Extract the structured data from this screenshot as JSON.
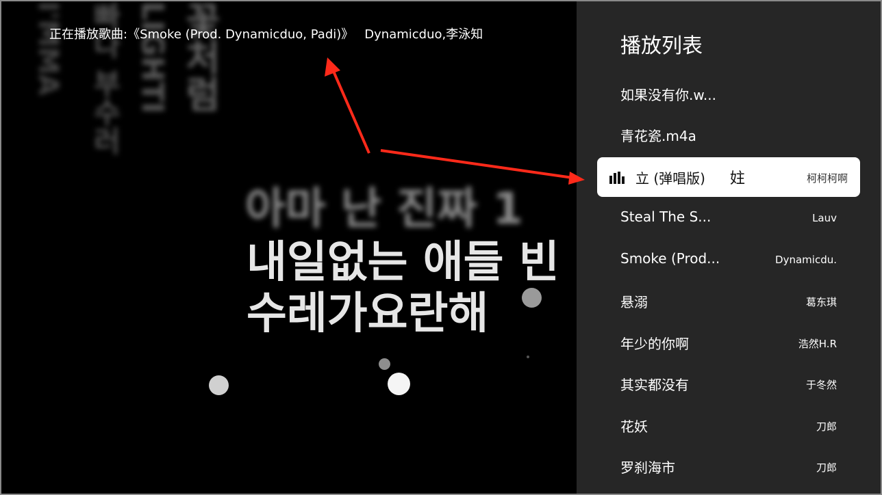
{
  "now_playing": {
    "prefix": "正在播放歌曲:",
    "song": "《Smoke (Prod. Dynamicduo, Padi)》",
    "artists": "Dynamicduo,李泳知"
  },
  "background_lyrics": [
    "I'MMA",
    "빠다 부수러",
    "LIGHTI",
    "꽃처럼"
  ],
  "lyrics": {
    "previous": "아마 난 진짜 1",
    "current_line_1": "내일없는 애들 빈",
    "current_line_2": "수레가요란해"
  },
  "playlist": {
    "title": "播放列表",
    "tracks": [
      {
        "name": "如果没有你.w...",
        "artist": ""
      },
      {
        "name": "青花瓷.m4a",
        "artist": ""
      },
      {
        "name": "立 (弹唱版)",
        "extra": "妵",
        "artist": "柯柯柯啊",
        "playing": true
      },
      {
        "name": "Steal The S...",
        "artist": "Lauv"
      },
      {
        "name": "Smoke (Prod...",
        "artist": "Dynamicdu."
      },
      {
        "name": "悬溺",
        "artist": "葛东琪"
      },
      {
        "name": "年少的你啊",
        "artist": "浩然H.R"
      },
      {
        "name": "其实都没有",
        "artist": "于冬然"
      },
      {
        "name": "花妖",
        "artist": "刀郎"
      },
      {
        "name": "罗刹海市",
        "artist": "刀郎"
      }
    ]
  },
  "colors": {
    "panel_bg": "#262626",
    "stage_bg": "#000000",
    "active_row_bg": "#ffffff",
    "annotation_arrow": "#ff2a1a"
  },
  "icons": {
    "playing_indicator": "equalizer-bars-icon"
  }
}
